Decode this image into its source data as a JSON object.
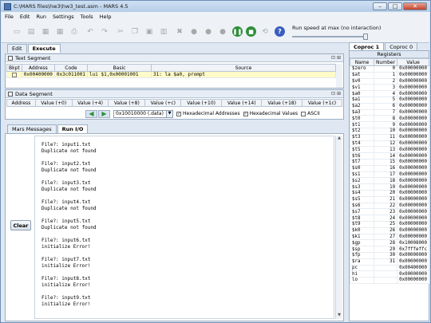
{
  "window": {
    "title": "C:\\MARS files\\hw3\\hw3_test.asm - MARS 4.5",
    "min": "–",
    "max": "□",
    "close": "✕"
  },
  "menu": [
    "File",
    "Edit",
    "Run",
    "Settings",
    "Tools",
    "Help"
  ],
  "toolbar": {
    "speed_label": "Run speed at max (no interaction)"
  },
  "tabs": {
    "edit": "Edit",
    "execute": "Execute"
  },
  "text_segment": {
    "title": "Text Segment",
    "controls": "⊡ ⊞",
    "columns": [
      "Bkpt",
      "Address",
      "Code",
      "Basic",
      "Source"
    ],
    "rows": [
      {
        "addr": "0x00400000",
        "code": "0x3c011001",
        "basic": "lui $1,0x00001001",
        "source": "31:    la $a0, prompt"
      }
    ]
  },
  "data_segment": {
    "title": "Data Segment",
    "controls": "⊡ ⊞",
    "columns": [
      "Address",
      "Value (+0)",
      "Value (+4)",
      "Value (+8)",
      "Value (+c)",
      "Value (+10)",
      "Value (+14)",
      "Value (+18)",
      "Value (+1c)"
    ],
    "selector": "0x10010000 (.data)",
    "hex_addresses": "Hexadecimal Addresses",
    "hex_values": "Hexadecimal Values",
    "ascii": "ASCII"
  },
  "messages": {
    "tab_mars": "Mars Messages",
    "tab_runio": "Run I/O",
    "clear": "Clear",
    "lines": [
      "File?: input1.txt",
      "Duplicate not found",
      "",
      "File?: input2.txt",
      "Duplicate not found",
      "",
      "File?: input3.txt",
      "Duplicate not found",
      "",
      "File?: input4.txt",
      "Duplicate not found",
      "",
      "File?: input5.txt",
      "Duplicate not found",
      "",
      "File?: input6.txt",
      "initialize Error!",
      "",
      "File?: input7.txt",
      "initialize Error!",
      "",
      "File?: input8.txt",
      "initialize Error!",
      "",
      "File?: input9.txt",
      "initialize Error!"
    ]
  },
  "registers": {
    "tab1": "Coproc 1",
    "tab2": "Coproc 0",
    "title": "Registers",
    "columns": [
      "Name",
      "Number",
      "Value"
    ],
    "rows": [
      [
        "$zero",
        "0",
        "0x00000000"
      ],
      [
        "$at",
        "1",
        "0x00000000"
      ],
      [
        "$v0",
        "2",
        "0x00000000"
      ],
      [
        "$v1",
        "3",
        "0x00000000"
      ],
      [
        "$a0",
        "4",
        "0x00000000"
      ],
      [
        "$a1",
        "5",
        "0x00000000"
      ],
      [
        "$a2",
        "6",
        "0x00000000"
      ],
      [
        "$a3",
        "7",
        "0x00000000"
      ],
      [
        "$t0",
        "8",
        "0x00000000"
      ],
      [
        "$t1",
        "9",
        "0x00000000"
      ],
      [
        "$t2",
        "10",
        "0x00000000"
      ],
      [
        "$t3",
        "11",
        "0x00000000"
      ],
      [
        "$t4",
        "12",
        "0x00000000"
      ],
      [
        "$t5",
        "13",
        "0x00000000"
      ],
      [
        "$t6",
        "14",
        "0x00000000"
      ],
      [
        "$t7",
        "15",
        "0x00000000"
      ],
      [
        "$s0",
        "16",
        "0x00000000"
      ],
      [
        "$s1",
        "17",
        "0x00000000"
      ],
      [
        "$s2",
        "18",
        "0x00000000"
      ],
      [
        "$s3",
        "19",
        "0x00000000"
      ],
      [
        "$s4",
        "20",
        "0x00000000"
      ],
      [
        "$s5",
        "21",
        "0x00000000"
      ],
      [
        "$s6",
        "22",
        "0x00000000"
      ],
      [
        "$s7",
        "23",
        "0x00000000"
      ],
      [
        "$t8",
        "24",
        "0x00000000"
      ],
      [
        "$t9",
        "25",
        "0x00000000"
      ],
      [
        "$k0",
        "26",
        "0x00000000"
      ],
      [
        "$k1",
        "27",
        "0x00000000"
      ],
      [
        "$gp",
        "28",
        "0x10008000"
      ],
      [
        "$sp",
        "29",
        "0x7fffeffc"
      ],
      [
        "$fp",
        "30",
        "0x00000000"
      ],
      [
        "$ra",
        "31",
        "0x00000000"
      ],
      [
        "pc",
        "",
        "0x00400000"
      ],
      [
        "hi",
        "",
        "0x00000000"
      ],
      [
        "lo",
        "",
        "0x00000000"
      ]
    ]
  }
}
